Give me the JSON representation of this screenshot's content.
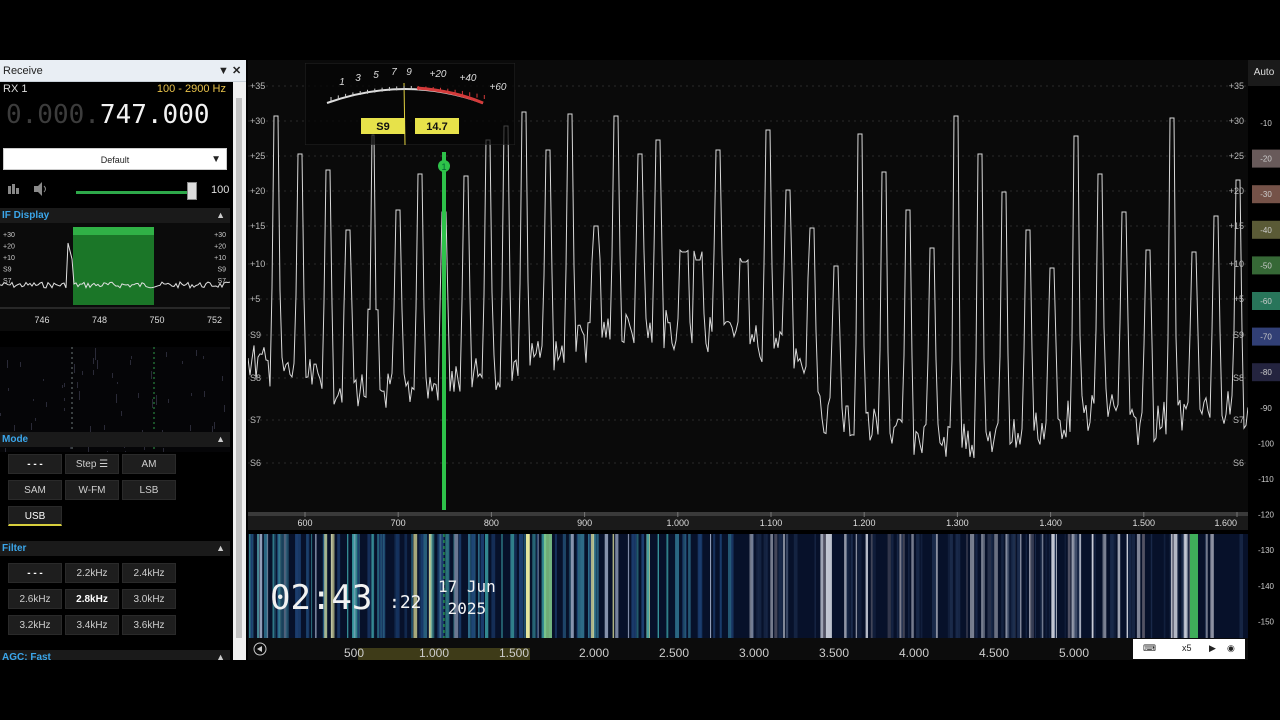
{
  "panel": {
    "title": "Receive",
    "rx_label": "RX 1",
    "bandwidth": "100 - 2900 Hz",
    "frequency_dim": "0.000.",
    "frequency_bright": "747.000",
    "preset": "Default",
    "volume_value": "100",
    "volume_level": 0.97
  },
  "if_display": {
    "title": "IF Display",
    "left_scale": [
      "+30",
      "+20",
      "+10",
      "S9",
      "S7"
    ],
    "right_scale": [
      "+30",
      "+20",
      "+10",
      "S9",
      "S7"
    ],
    "freq_labels": [
      "746",
      "748",
      "750",
      "752"
    ]
  },
  "mode": {
    "title": "Mode",
    "buttons": [
      "- - -",
      "Step ☰",
      "AM",
      "SAM",
      "W-FM",
      "LSB",
      "USB"
    ],
    "selected": "USB"
  },
  "filter": {
    "title": "Filter",
    "buttons": [
      "- - -",
      "2.2kHz",
      "2.4kHz",
      "2.6kHz",
      "2.8kHz",
      "3.0kHz",
      "3.2kHz",
      "3.4kHz",
      "3.6kHz"
    ],
    "selected": "2.8kHz"
  },
  "agc": {
    "title": "AGC: Fast"
  },
  "smeter": {
    "scale": [
      "1",
      "3",
      "5",
      "7",
      "9",
      "+20",
      "+40",
      "+60"
    ],
    "s_reading": "S9",
    "db_reading": "14.7"
  },
  "spectrum": {
    "left_axis": [
      "+35",
      "+30",
      "+25",
      "+20",
      "+15",
      "+10",
      "+5",
      "S9",
      "S8",
      "S7",
      "S6"
    ],
    "right_axis": [
      "+35",
      "+30",
      "+25",
      "+20",
      "+15",
      "+10",
      "+5",
      "S9",
      "S8",
      "S7",
      "S6"
    ],
    "freq_axis": [
      "600",
      "700",
      "800",
      "900",
      "1.000",
      "1.100",
      "1.200",
      "1.300",
      "1.400",
      "1.500",
      "1.600"
    ],
    "marker_label": "1",
    "marker_color": "#2ec24a"
  },
  "right_scale": {
    "auto_label": "Auto",
    "ticks": [
      "-10",
      "-20",
      "-30",
      "-40",
      "-50",
      "-60",
      "-70",
      "-80",
      "-90",
      "-100",
      "-110",
      "-120",
      "-130",
      "-140",
      "-150"
    ]
  },
  "waterfall": {
    "freq_axis": [
      "500",
      "1.000",
      "1.500",
      "2.000",
      "2.500",
      "3.000",
      "3.500",
      "4.000",
      "4.500",
      "5.000"
    ],
    "zoom": "x5"
  },
  "clock": {
    "time": "02:43",
    "seconds": ":22",
    "date_line1": "17 Jun",
    "date_line2": "2025"
  }
}
